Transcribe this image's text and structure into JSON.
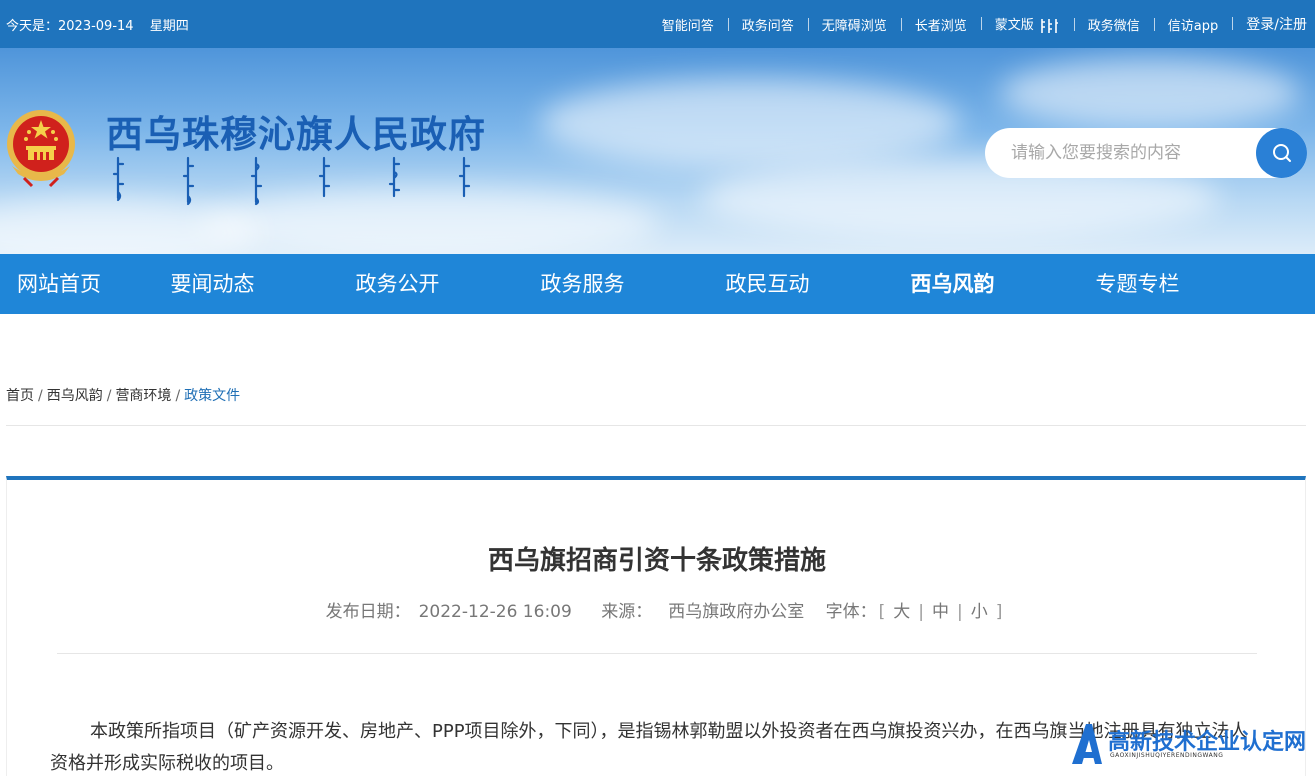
{
  "topbar": {
    "date_label": "今天是：2023-09-14",
    "weekday": "星期四",
    "links": [
      "智能问答",
      "政务问答",
      "无障碍浏览",
      "长者浏览",
      "蒙文版",
      "政务微信",
      "信访app"
    ],
    "login": "登录/注册"
  },
  "header": {
    "site_title": "西乌珠穆沁旗人民政府",
    "search_placeholder": "请输入您要搜索的内容"
  },
  "nav": {
    "items": [
      "网站首页",
      "要闻动态",
      "政务公开",
      "政务服务",
      "政民互动",
      "西乌风韵",
      "专题专栏"
    ],
    "active_index": 5
  },
  "breadcrumb": {
    "items": [
      "首页",
      "西乌风韵",
      "营商环境",
      "政策文件"
    ],
    "separator": "/"
  },
  "article": {
    "title": "西乌旗招商引资十条政策措施",
    "date_label": "发布日期：",
    "date_value": "2022-12-26 16:09",
    "source_label": "来源：",
    "source_value": "西乌旗政府办公室",
    "font_label": "字体：",
    "bracket_open": "[",
    "bracket_close": "]",
    "font_sizes": [
      "大",
      "中",
      "小"
    ],
    "paragraph": "本政策所指项目（矿产资源开发、房地产、PPP项目除外，下同），是指锡林郭勒盟以外投资者在西乌旗投资兴办，在西乌旗当地注册具有独立法人资格并形成实际税收的项目。"
  },
  "watermark": {
    "text": "高新技术企业认定网",
    "sub": "GAOXINJISHUQIYERENDINGWANG"
  },
  "colors": {
    "topbar": "#1f74bd",
    "nav": "#1f86d8",
    "title_blue": "#1a5fb4"
  }
}
